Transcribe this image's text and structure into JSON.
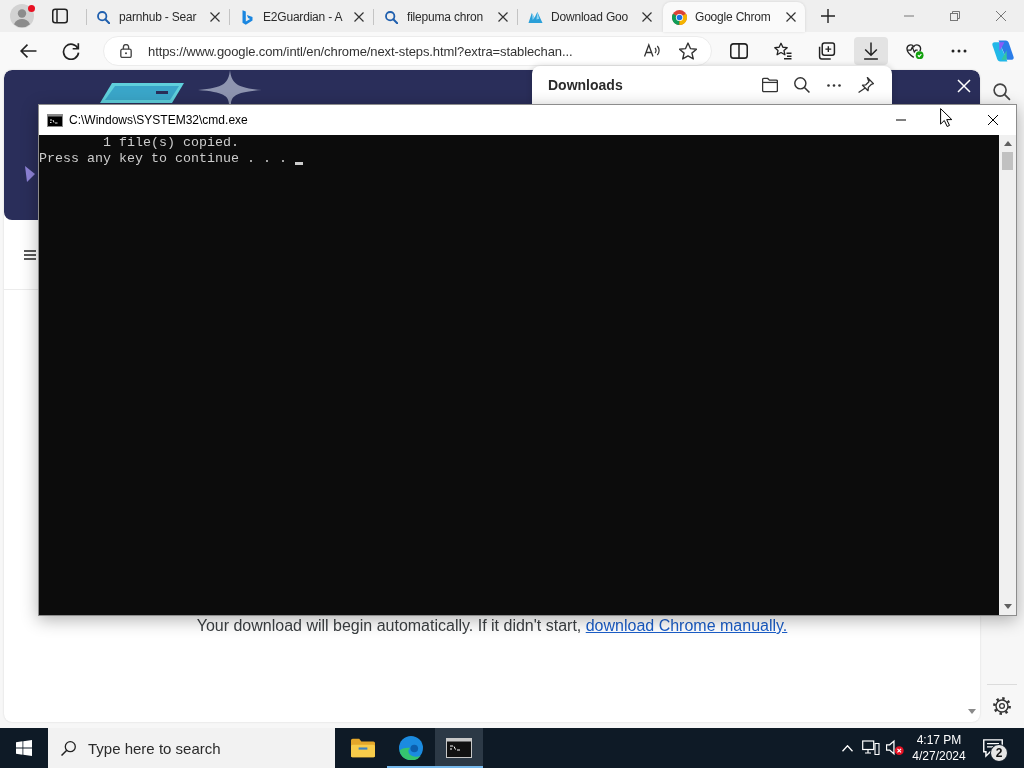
{
  "browser": {
    "tabs": [
      {
        "kind": "search",
        "title": "parnhub - Sear",
        "selected": false
      },
      {
        "kind": "bing",
        "title": "E2Guardian - A",
        "selected": false
      },
      {
        "kind": "search",
        "title": "filepuma chron",
        "selected": false
      },
      {
        "kind": "site",
        "title": "Download Goo",
        "selected": false
      },
      {
        "kind": "chrome",
        "title": "Google Chrom",
        "selected": true
      }
    ],
    "address_bar": {
      "url": "https://www.google.com/intl/en/chrome/next-steps.html?extra=stablechan..."
    },
    "toolbar_buttons": [
      {
        "kind": "split_screen",
        "selected": false
      },
      {
        "kind": "favorites",
        "selected": false
      },
      {
        "kind": "collections",
        "selected": false
      },
      {
        "kind": "downloads",
        "selected": true
      },
      {
        "kind": "performance",
        "selected": false
      },
      {
        "kind": "more",
        "selected": false
      },
      {
        "kind": "copilot",
        "selected": false
      }
    ],
    "downloads_panel": {
      "title": "Downloads"
    },
    "page": {
      "message": "Your download will begin automatically. If it didn't start,",
      "link": "download Chrome manually."
    }
  },
  "console": {
    "title": "C:\\Windows\\SYSTEM32\\cmd.exe",
    "lines": [
      "        1 file(s) copied.",
      "Press any key to continue . . ."
    ]
  },
  "taskbar": {
    "search_placeholder": "Type here to search",
    "apps": [
      {
        "kind": "files",
        "running": false,
        "selected": false
      },
      {
        "kind": "browser",
        "running": true,
        "selected": false
      },
      {
        "kind": "console",
        "running": true,
        "selected": true
      }
    ],
    "time": "4:17 PM",
    "date": "4/27/2024",
    "notification_count": "2"
  }
}
